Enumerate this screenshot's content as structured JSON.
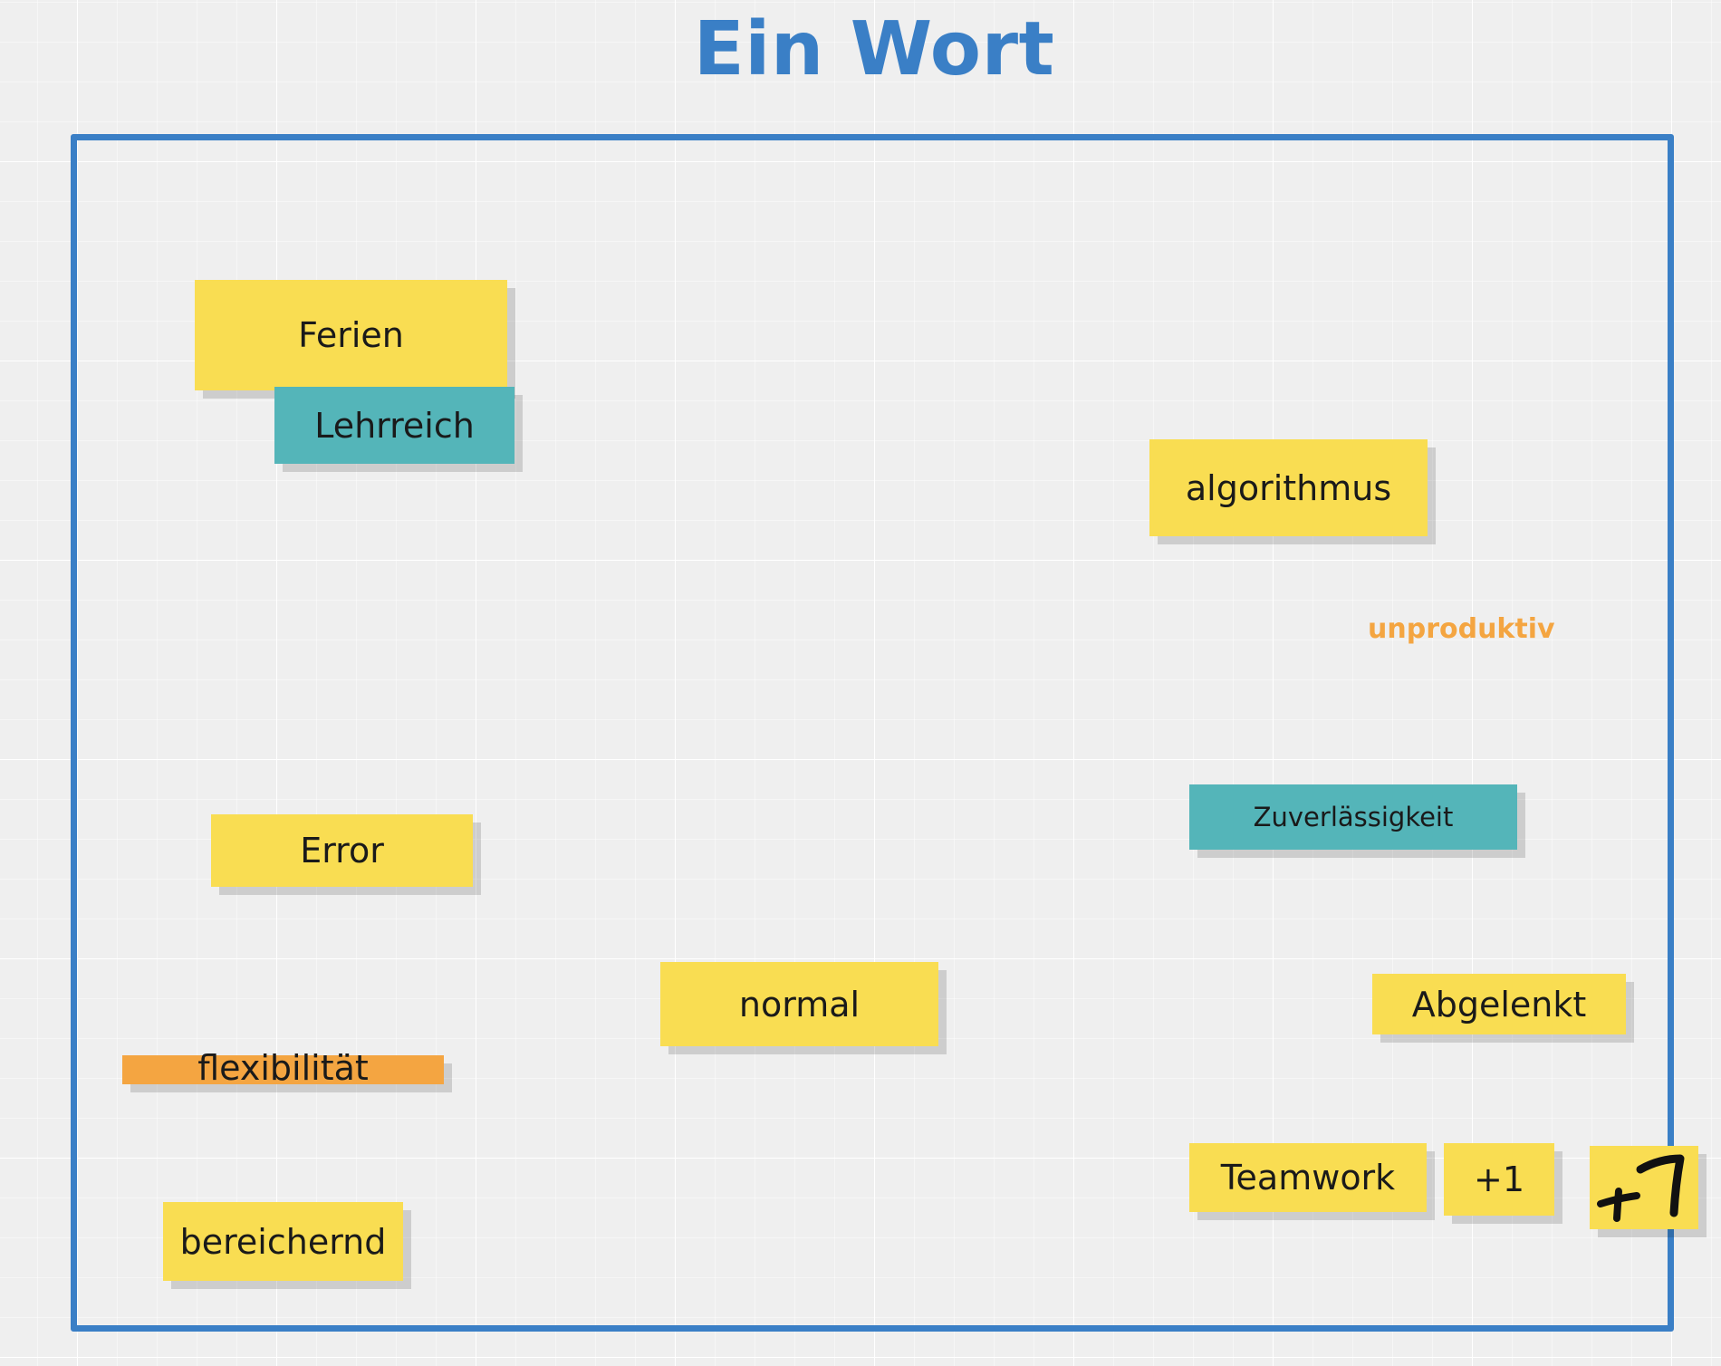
{
  "board": {
    "title": "Ein Wort",
    "frame_color": "#3a7fc6",
    "title_color": "#3a7fc6",
    "background_color": "#efefef"
  },
  "notes": [
    {
      "id": "ferien",
      "text": "Ferien",
      "color": "#f9dd52"
    },
    {
      "id": "lehrreich",
      "text": "Lehrreich",
      "color": "#54b5b9"
    },
    {
      "id": "algorithmus",
      "text": "algorithmus",
      "color": "#f9dd52"
    },
    {
      "id": "error",
      "text": "Error",
      "color": "#f9dd52"
    },
    {
      "id": "zuverlaessigkeit",
      "text": "Zuverlässigkeit",
      "color": "#54b5b9"
    },
    {
      "id": "normal",
      "text": "normal",
      "color": "#f9dd52"
    },
    {
      "id": "abgelenkt",
      "text": "Abgelenkt",
      "color": "#f9dd52"
    },
    {
      "id": "flexibilitaet",
      "text": "flexibilität",
      "color": "#f4a541"
    },
    {
      "id": "teamwork",
      "text": "Teamwork",
      "color": "#f9dd52"
    },
    {
      "id": "plus-one",
      "text": "+1",
      "color": "#f9dd52"
    },
    {
      "id": "bereichernd",
      "text": "bereichernd",
      "color": "#f9dd52"
    }
  ],
  "free_text": [
    {
      "id": "unproduktiv",
      "text": "unproduktiv",
      "color": "#f4a541"
    }
  ],
  "ink_note": {
    "description": "handwritten +1",
    "color": "#f9dd52",
    "ink_color": "#111111"
  }
}
